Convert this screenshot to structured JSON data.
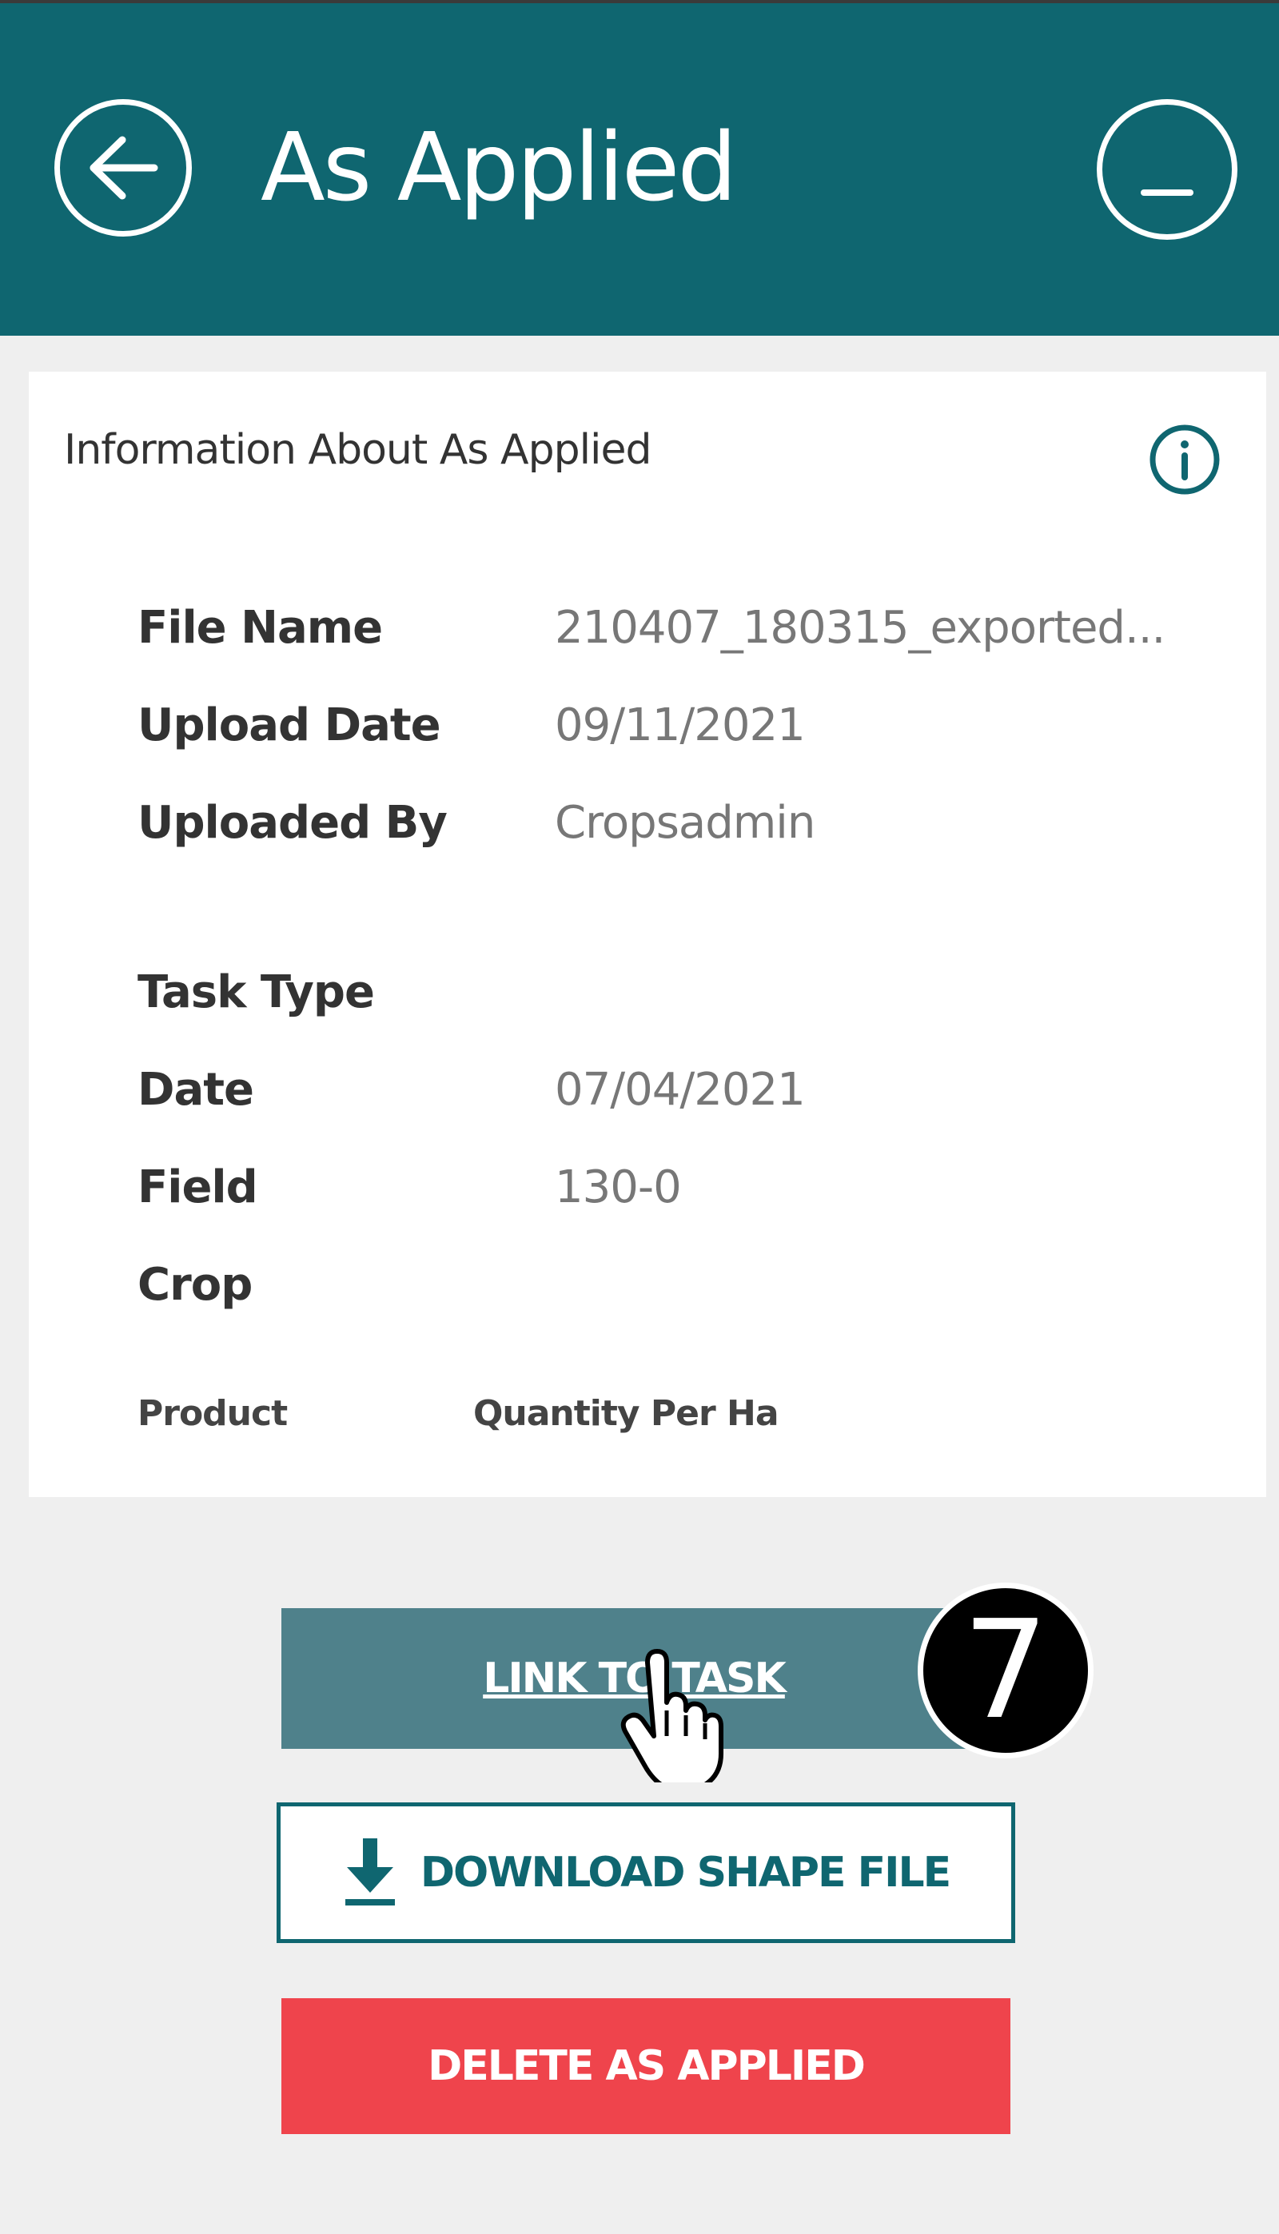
{
  "header": {
    "title": "As Applied"
  },
  "card": {
    "title": "Information About As Applied",
    "rows": [
      {
        "label": "File Name",
        "value": "210407_180315_exported..."
      },
      {
        "label": "Upload Date",
        "value": "09/11/2021"
      },
      {
        "label": "Uploaded By",
        "value": "Cropsadmin"
      },
      {
        "label": "Task Type",
        "value": ""
      },
      {
        "label": "Date",
        "value": "07/04/2021"
      },
      {
        "label": "Field",
        "value": "130-0"
      },
      {
        "label": "Crop",
        "value": ""
      }
    ],
    "product_header": "Product",
    "quantity_header": "Quantity Per Ha"
  },
  "actions": {
    "link_label": "LINK TO TASK",
    "download_label": "DOWNLOAD SHAPE FILE",
    "delete_label": "DELETE AS APPLIED"
  },
  "step_badge": "7",
  "colors": {
    "header": "#0f6670",
    "link_button": "#4f818b",
    "delete_button": "#ef444c"
  }
}
